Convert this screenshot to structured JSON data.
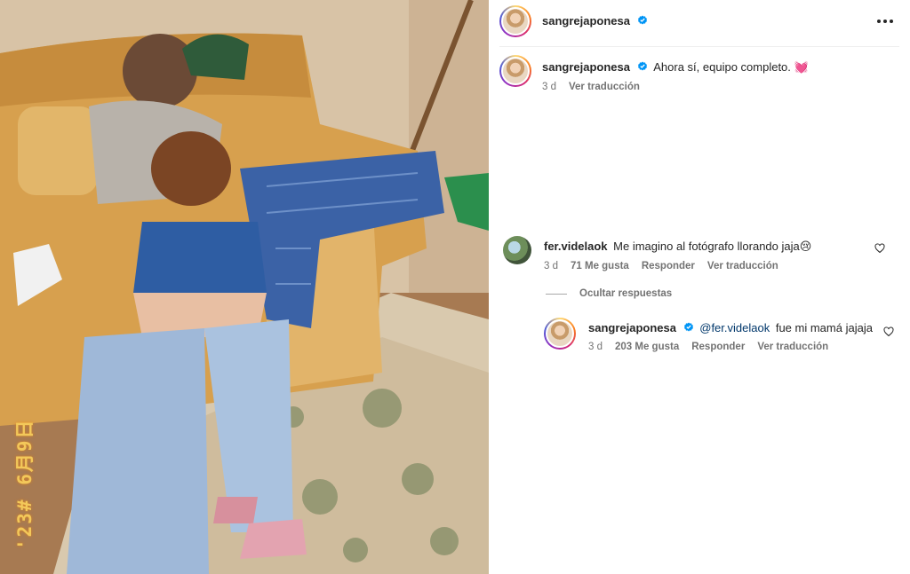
{
  "photo": {
    "date_stamp": "'23# 6月9日",
    "alt_subject": ""
  },
  "post": {
    "username": "sangrejaponesa",
    "verified": true,
    "caption": {
      "username": "sangrejaponesa",
      "text": "Ahora sí, equipo completo. 💓",
      "time": "3 d",
      "translate": "Ver traducción"
    }
  },
  "comments": [
    {
      "username": "fer.videlaok",
      "text": "Me imagino al fotógrafo llorando jaja😢",
      "time": "3 d",
      "likes": "71 Me gusta",
      "reply": "Responder",
      "translate": "Ver traducción",
      "hide_replies": "Ocultar respuestas",
      "replies": [
        {
          "username": "sangrejaponesa",
          "mention": "@fer.videlaok",
          "text": "fue mi mamá jajaja",
          "time": "3 d",
          "likes": "203 Me gusta",
          "reply": "Responder",
          "translate": "Ver traducción"
        }
      ]
    }
  ],
  "colors": {
    "verified": "#0095f6",
    "text": "#262626",
    "muted": "#737373",
    "mention": "#00376b"
  },
  "icons": [
    "more-options-icon",
    "verified-badge-icon",
    "heart-icon"
  ]
}
